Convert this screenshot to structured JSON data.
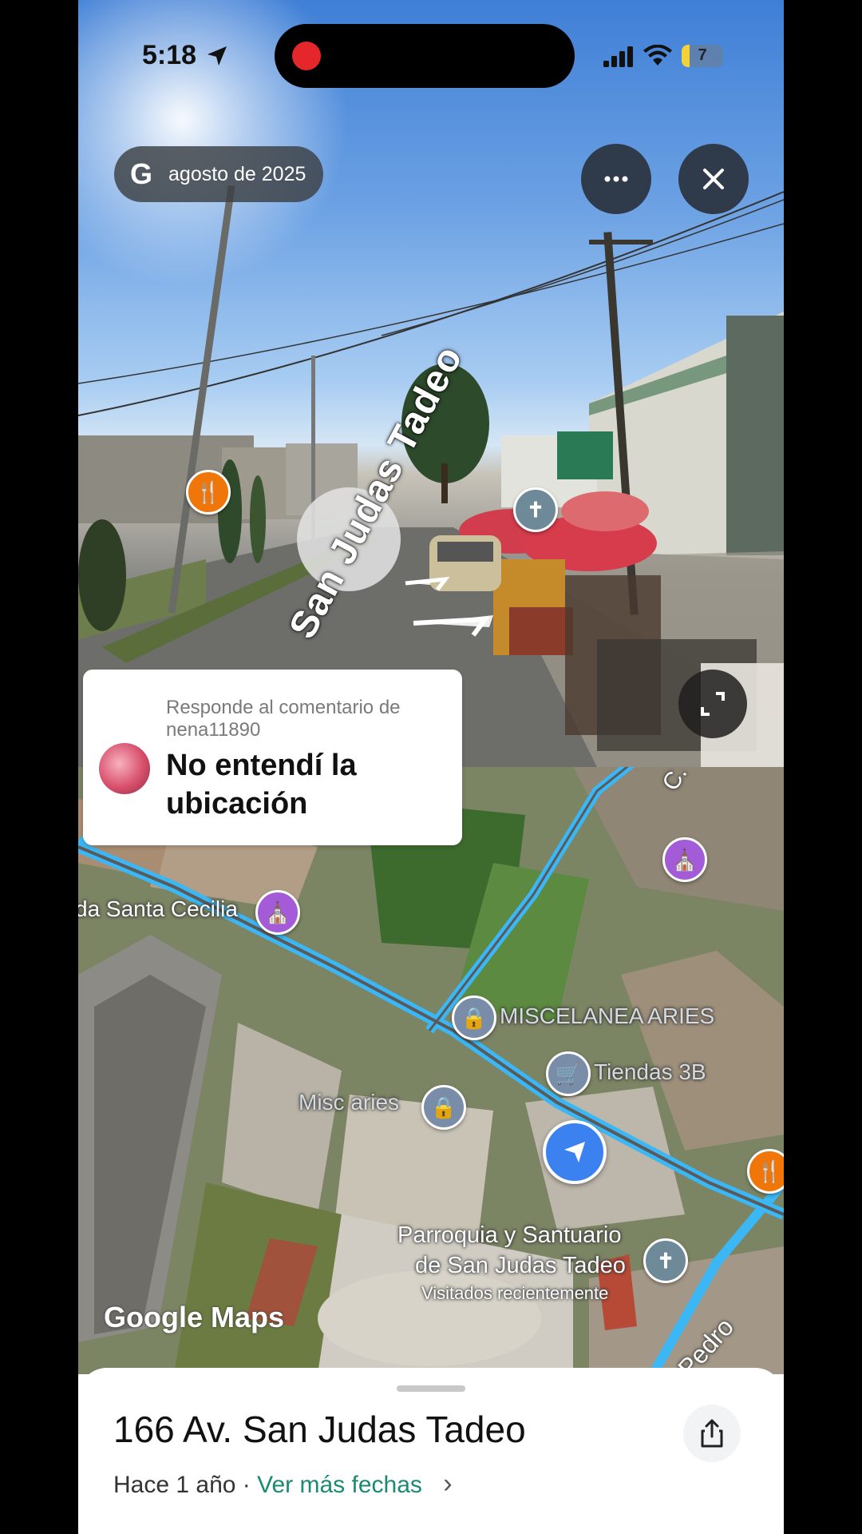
{
  "status_bar": {
    "time": "5:18",
    "battery": "7",
    "battery_level_fraction": 0.07
  },
  "street_view": {
    "date": "agosto de 2025",
    "google_badge": "G",
    "street_label": "San Judas Tadeo",
    "icons": [
      "location-arrow-icon",
      "more-options-icon",
      "close-icon",
      "fullscreen-icon",
      "restaurant-icon",
      "church-icon"
    ]
  },
  "comment": {
    "reply_to": "Responde al comentario de nena11890",
    "text": "No entendí la ubicación"
  },
  "map": {
    "labels": {
      "santa_cecilia": "da Santa Cecilia",
      "miscelanea_aries": "MISCELANEA ARIES",
      "tiendas_3b": "Tiendas 3B",
      "misc_aries": "Misc aries",
      "parroquia_line1": "Parroquia y Santuario",
      "parroquia_line2": "de San Judas Tadeo",
      "parroquia_line3": "Visitados recientemente",
      "street_c": "C. S",
      "street_pedro": "Pedro"
    },
    "watermark": "Google Maps",
    "colors": {
      "road": "#39b6f5",
      "accent_blue": "#3b82f0",
      "purple_pin": "#a45bd8",
      "orange_pin": "#f0760a"
    }
  },
  "bottom_sheet": {
    "address": "166 Av. San Judas Tadeo",
    "time_ago": "Hace 1 año",
    "separator": " · ",
    "more_dates": "Ver más fechas",
    "chevron": "›"
  }
}
